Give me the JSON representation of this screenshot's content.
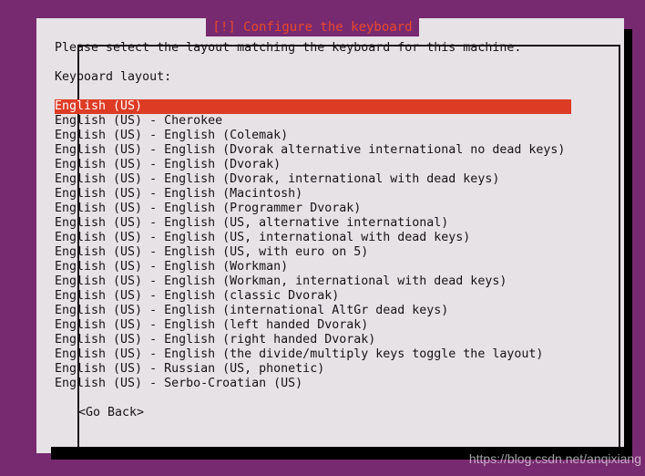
{
  "screen": {
    "background_color": "#772a70",
    "dialog_background_color": "#e7e2e6",
    "accent_color": "#dd3b24",
    "title_color": "#e8482b",
    "text_color": "#161216"
  },
  "dialog": {
    "title": "[!] Configure the keyboard",
    "intro_text": "Please select the layout matching the keyboard for this machine.",
    "field_label": "Keyboard layout:",
    "selected_index": 0,
    "items": [
      "English (US)",
      "English (US) - Cherokee",
      "English (US) - English (Colemak)",
      "English (US) - English (Dvorak alternative international no dead keys)",
      "English (US) - English (Dvorak)",
      "English (US) - English (Dvorak, international with dead keys)",
      "English (US) - English (Macintosh)",
      "English (US) - English (Programmer Dvorak)",
      "English (US) - English (US, alternative international)",
      "English (US) - English (US, international with dead keys)",
      "English (US) - English (US, with euro on 5)",
      "English (US) - English (Workman)",
      "English (US) - English (Workman, international with dead keys)",
      "English (US) - English (classic Dvorak)",
      "English (US) - English (international AltGr dead keys)",
      "English (US) - English (left handed Dvorak)",
      "English (US) - English (right handed Dvorak)",
      "English (US) - English (the divide/multiply keys toggle the layout)",
      "English (US) - Russian (US, phonetic)",
      "English (US) - Serbo-Croatian (US)"
    ],
    "go_back_label": "<Go Back>"
  },
  "watermark": {
    "text": "https://blog.csdn.net/anqixiang"
  }
}
